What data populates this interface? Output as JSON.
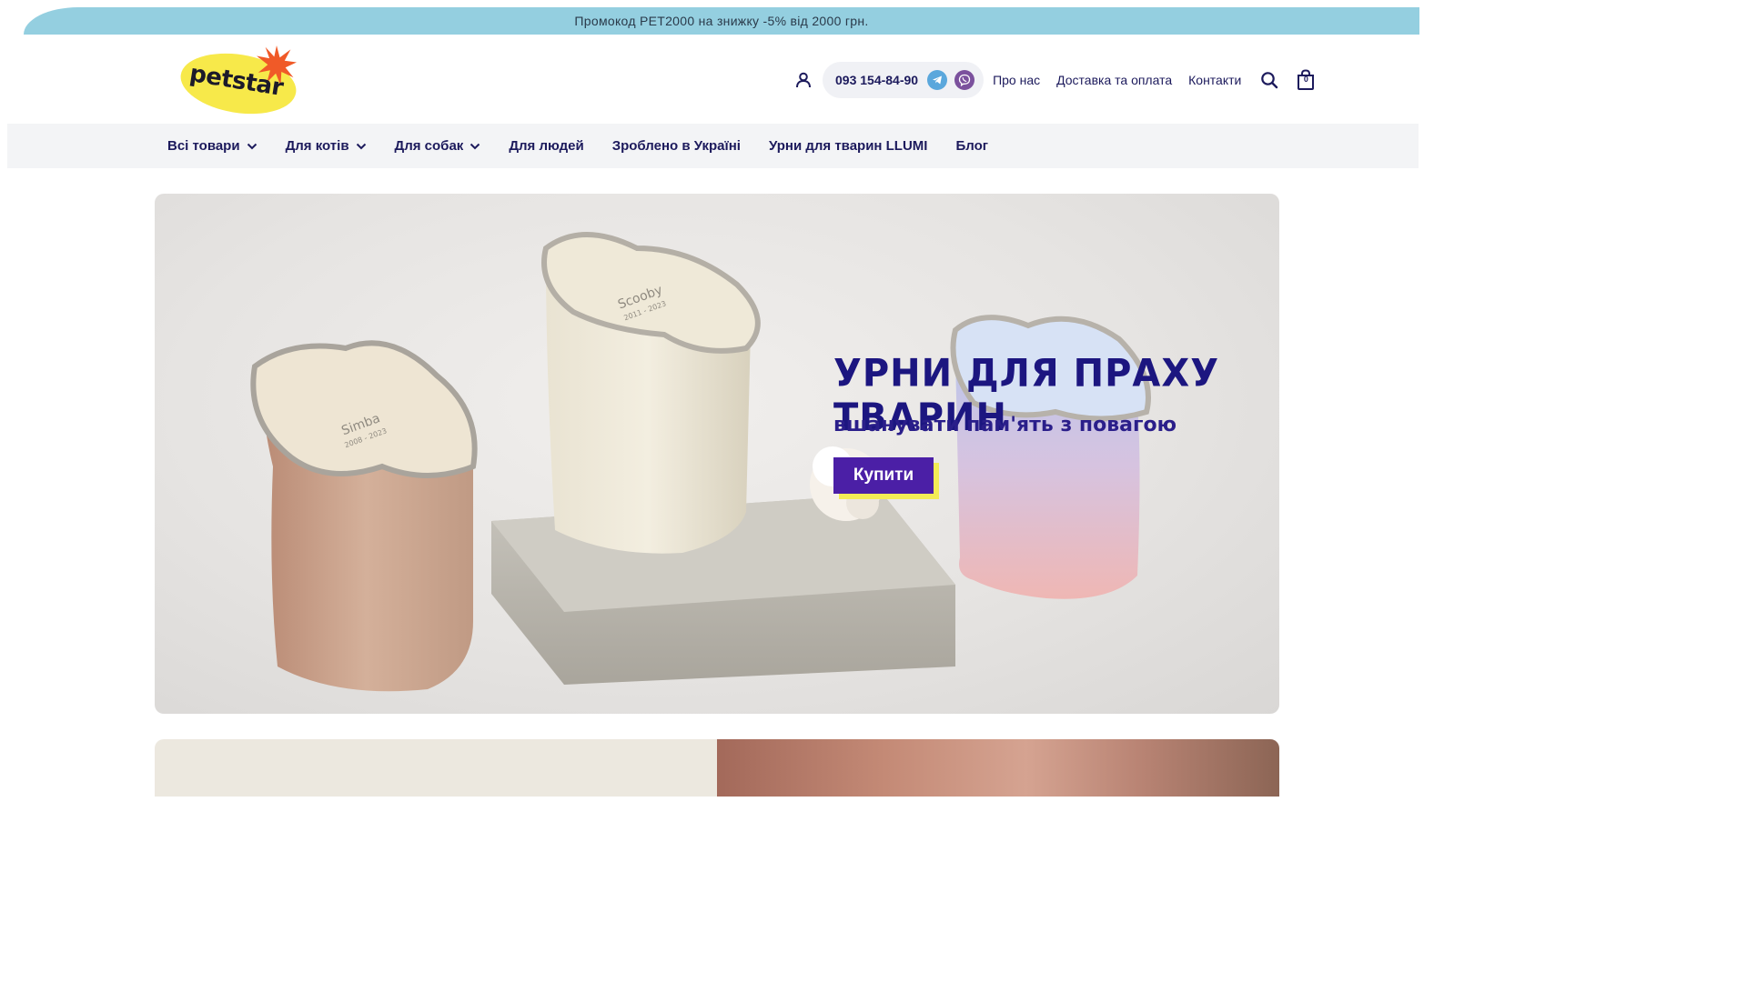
{
  "promo": {
    "text": "Промокод PET2000 на знижку -5% від 2000 грн."
  },
  "logo": {
    "text": "petstar"
  },
  "header": {
    "phone": "093 154-84-90",
    "links": [
      "Про нас",
      "Доставка та оплата",
      "Контакти"
    ],
    "cart_count": "0",
    "icons": [
      "user-icon",
      "telegram-icon",
      "viber-icon",
      "search-icon",
      "cart-icon"
    ]
  },
  "nav": {
    "items": [
      {
        "label": "Всі товари",
        "dropdown": true
      },
      {
        "label": "Для котів",
        "dropdown": true
      },
      {
        "label": "Для собак",
        "dropdown": true
      },
      {
        "label": "Для людей",
        "dropdown": false
      },
      {
        "label": "Зроблено в Україні",
        "dropdown": false
      },
      {
        "label": "Урни для тварин LLUMI",
        "dropdown": false
      },
      {
        "label": "Блог",
        "dropdown": false
      }
    ]
  },
  "hero": {
    "title": "УРНИ ДЛЯ ПРАХУ ТВАРИН",
    "subtitle": "вшанувати пам'ять з повагою",
    "button": "Купити",
    "urns": [
      {
        "name": "Simba",
        "years": "2008 - 2023"
      },
      {
        "name": "Scooby",
        "years": "2011 - 2023"
      }
    ]
  },
  "colors": {
    "promo_bg": "#94cfe0",
    "nav_bg": "#f3f4f6",
    "text_primary": "#1c1a5c",
    "hero_title": "#1c1680",
    "button_bg": "#4b1fa6",
    "button_shadow": "#f3ec56",
    "logo_yellow": "#f7e94a",
    "logo_orange": "#f05a28"
  }
}
